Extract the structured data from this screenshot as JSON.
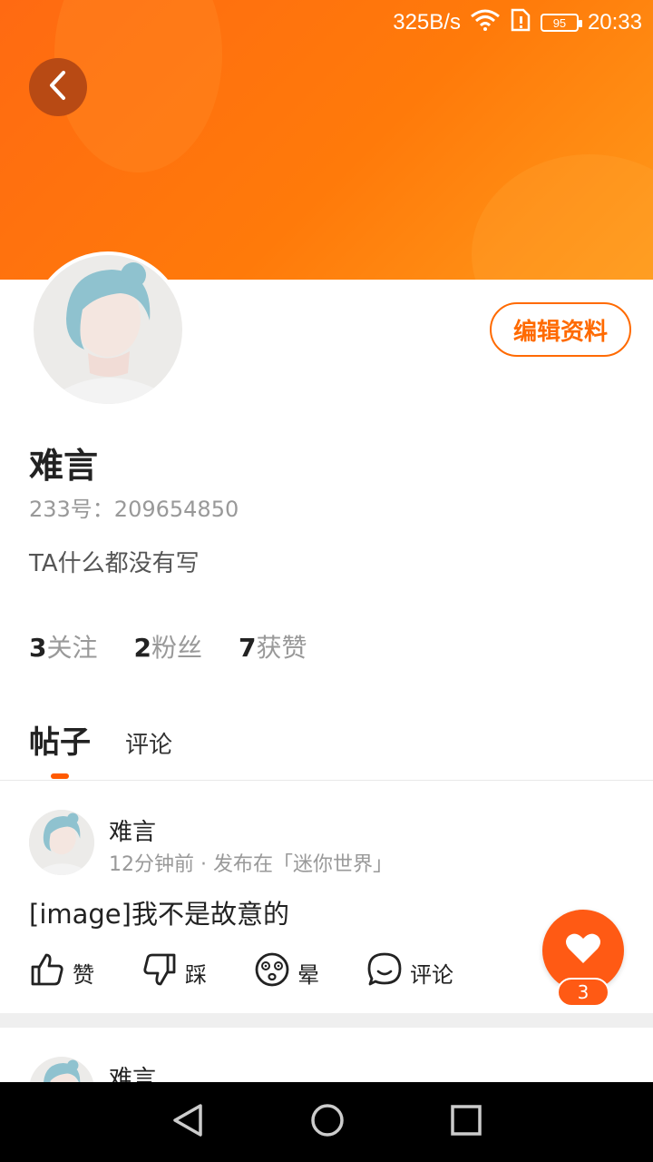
{
  "status_bar": {
    "speed": "325B/s",
    "battery": "95",
    "time": "20:33"
  },
  "profile": {
    "edit_label": "编辑资料",
    "name": "难言",
    "uid": "233号：209654850",
    "bio": "TA什么都没有写",
    "stats": [
      {
        "num": "3",
        "label": "关注"
      },
      {
        "num": "2",
        "label": "粉丝"
      },
      {
        "num": "7",
        "label": "获赞"
      }
    ]
  },
  "tabs": {
    "posts": "帖子",
    "comments": "评论"
  },
  "post": {
    "author": "难言",
    "meta": "12分钟前 · 发布在「迷你世界」",
    "content": "[image]我不是故意的",
    "actions": {
      "like": "赞",
      "dislike": "踩",
      "dizzy": "晕",
      "comment": "评论"
    }
  },
  "fab": {
    "count": "3"
  },
  "post2": {
    "author": "难言"
  },
  "colors": {
    "accent": "#ff5a00",
    "header_start": "#ff6a12",
    "header_end": "#ff9a1a"
  }
}
